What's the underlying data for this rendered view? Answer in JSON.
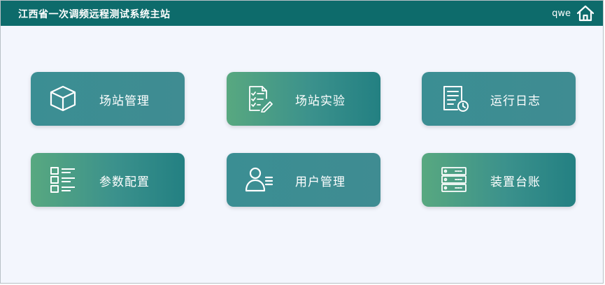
{
  "header": {
    "title": "江西省一次调频远程测试系统主站",
    "username": "qwe",
    "home_icon": "home-icon"
  },
  "tiles": [
    {
      "label": "场站管理",
      "icon": "cube-icon"
    },
    {
      "label": "场站实验",
      "icon": "checklist-edit-icon"
    },
    {
      "label": "运行日志",
      "icon": "document-clock-icon"
    },
    {
      "label": "参数配置",
      "icon": "list-icon"
    },
    {
      "label": "用户管理",
      "icon": "user-icon"
    },
    {
      "label": "装置台账",
      "icon": "server-icon"
    }
  ],
  "colors": {
    "header_bg": "#0d6b6b",
    "tile_plain": "#3f8c92",
    "tile_grad_start": "#58a880",
    "tile_grad_end": "#238082",
    "page_bg": "#f3f6fd"
  }
}
